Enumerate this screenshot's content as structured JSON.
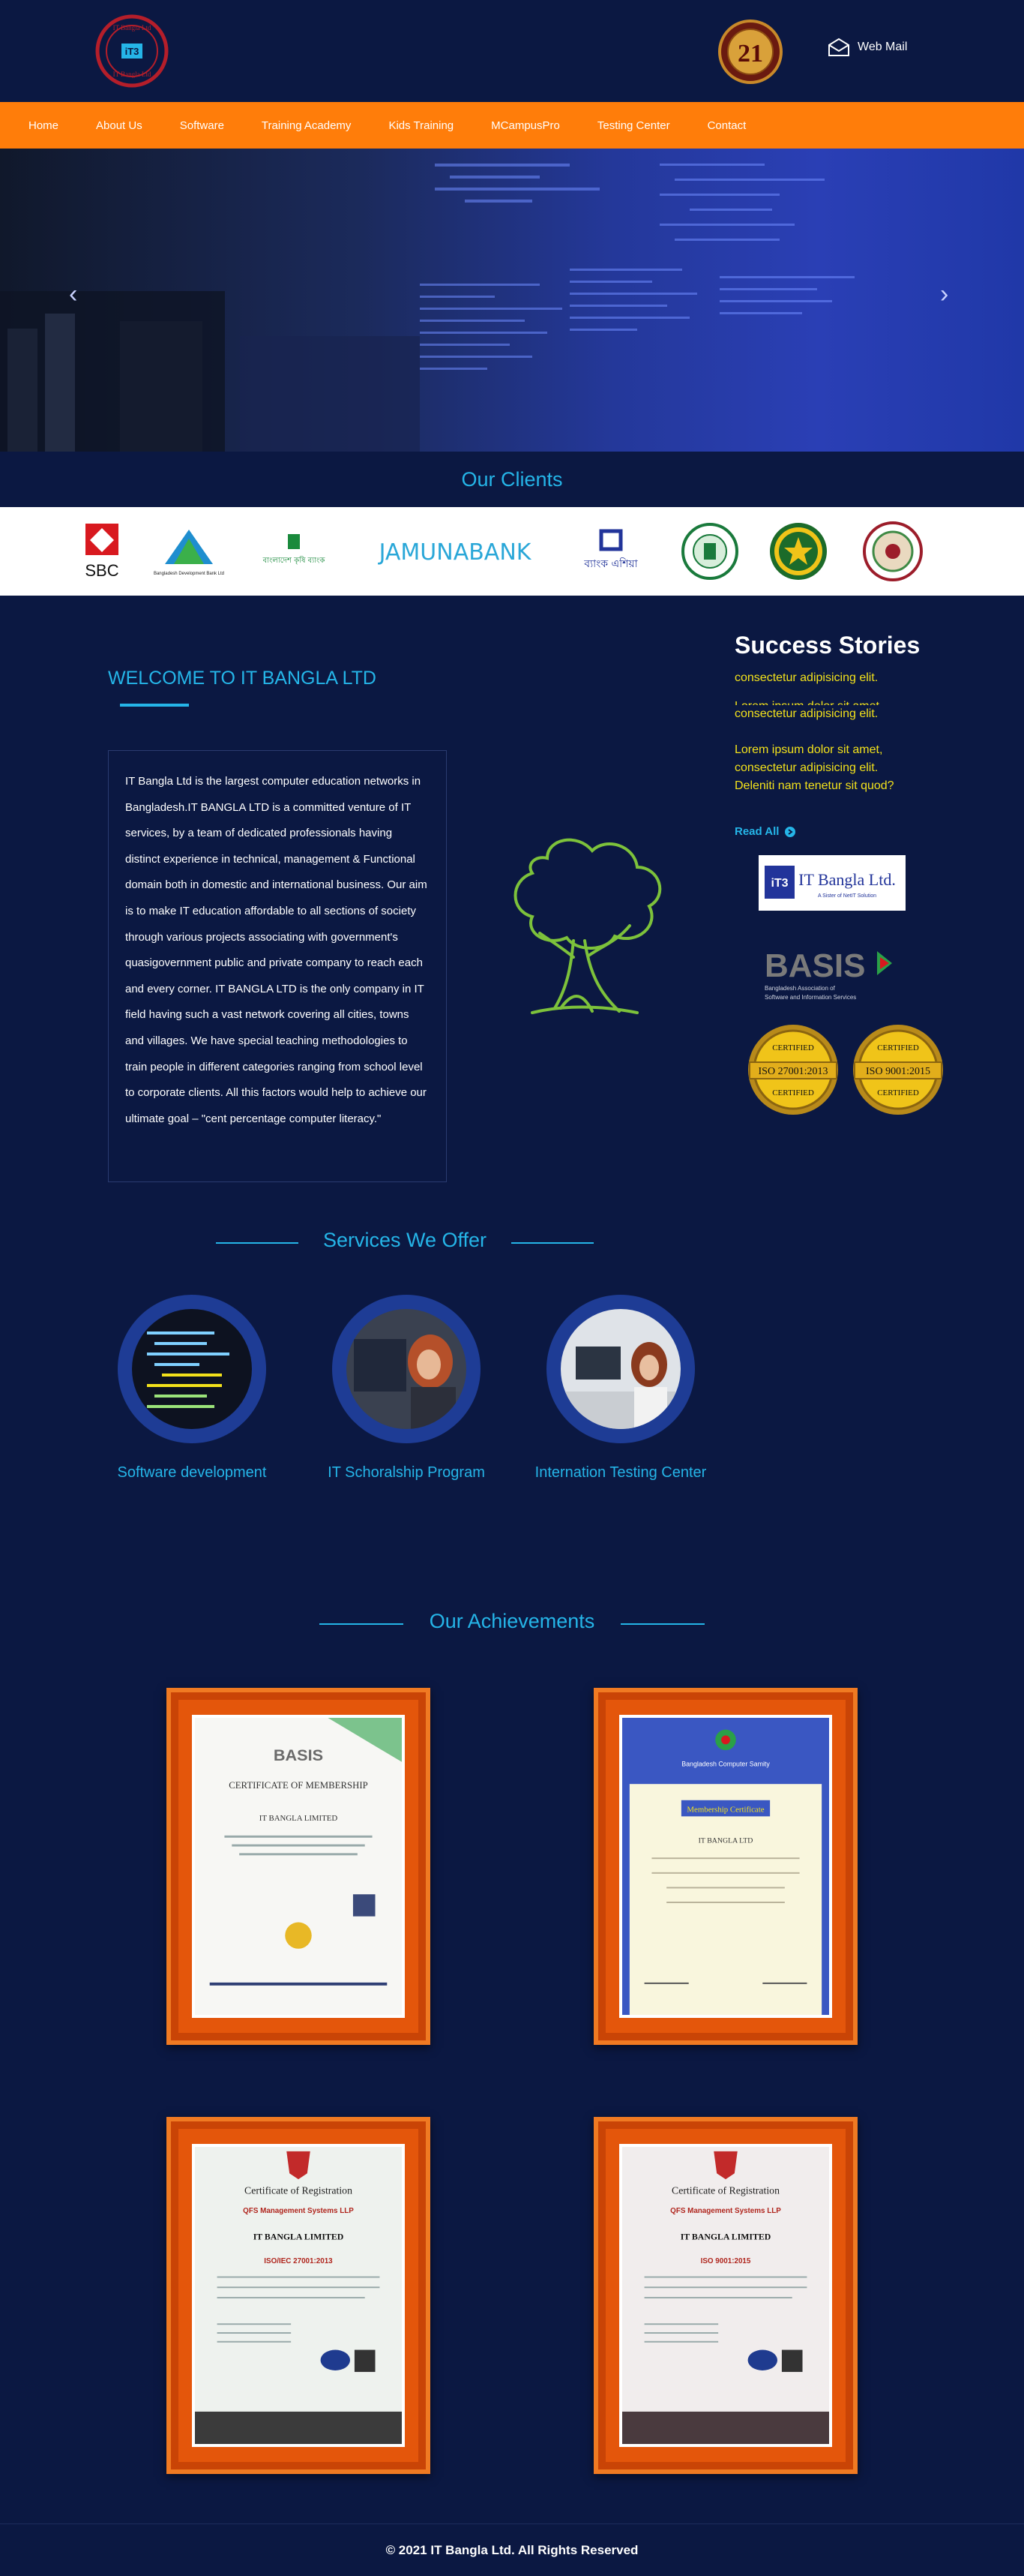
{
  "header": {
    "logo_text": "IT Bangla Ltd.",
    "badge_number": "21",
    "webmail_label": "Web Mail",
    "colors": {
      "background": "#0b1842",
      "accent": "#25b5e8",
      "nav": "#ff7d0a"
    }
  },
  "nav": {
    "items": [
      "Home",
      "About Us",
      "Software",
      "Training Academy",
      "Kids Training",
      "MCampusPro",
      "Testing Center",
      "Contact"
    ]
  },
  "hero": {
    "prev_icon": "chevron-left-icon",
    "next_icon": "chevron-right-icon"
  },
  "clients": {
    "title": "Our Clients",
    "logos": [
      "SBC",
      "Bangladesh Development Bank Ltd",
      "বাংলাদেশ কৃষি ব্যাংক",
      "JAMUNABANK",
      "ব্যাংক এশিয়া",
      "university-seal",
      "army-emblem",
      "circular-seal"
    ]
  },
  "welcome": {
    "title": "WELCOME TO IT BANGLA LTD",
    "body": "IT Bangla Ltd is the largest computer education networks in Bangladesh.IT BANGLA LTD is a committed venture of IT services, by a team of dedicated professionals having distinct experience in technical, management & Functional domain both in domestic and international business. Our aim is to make IT education affordable to all sections of society through various projects associating with government's quasigovernment public and private company to reach each and every corner. IT BANGLA LTD is the only company in IT field having such a vast network covering all cities, towns and villages. We have special teaching methodologies to train people in different categories ranging from school level to corporate clients. All this factors would help to achieve our ultimate goal – \"cent percentage computer literacy.\""
  },
  "success": {
    "title": "Success Stories",
    "lines": [
      "consectetur adipisicing elit.",
      "Lorem ipsum dolor sit amet,",
      "consectetur adipisicing elit.",
      "",
      "Lorem ipsum dolor sit amet,",
      "consectetur adipisicing elit.",
      "Deleniti nam tenetur sit quod?"
    ],
    "read_all": "Read All",
    "partner_itbangla": "IT Bangla Ltd.",
    "partner_itbangla_sub": "A Sister of NetIT Solution",
    "partner_basis": "BASIS",
    "partner_basis_sub1": "Bangladesh Association of",
    "partner_basis_sub2": "Software and Information Services",
    "iso1": "ISO 27001:2013",
    "iso2": "ISO 9001:2015",
    "certified": "CERTIFIED"
  },
  "services": {
    "title": "Services We Offer",
    "items": [
      "Software development",
      "IT Schoralship Program",
      "Internation Testing Center"
    ]
  },
  "achievements": {
    "title": "Our Achievements",
    "certs": [
      {
        "heading": "BASIS",
        "title": "CERTIFICATE OF MEMBERSHIP",
        "org": "IT BANGLA LIMITED"
      },
      {
        "heading": "Bangladesh Computer Samity",
        "title": "Membership Certificate",
        "org": "IT BANGLA LTD"
      },
      {
        "heading": "Certificate of Registration",
        "title": "QFS Management Systems LLP",
        "org": "IT BANGLA LIMITED",
        "standard": "ISO/IEC 27001:2013"
      },
      {
        "heading": "Certificate of Registration",
        "title": "QFS Management Systems LLP",
        "org": "IT BANGLA LIMITED",
        "standard": "ISO 9001:2015"
      }
    ]
  },
  "footer": {
    "copyright": "© 2021 IT Bangla Ltd. All Rights Reserved"
  }
}
